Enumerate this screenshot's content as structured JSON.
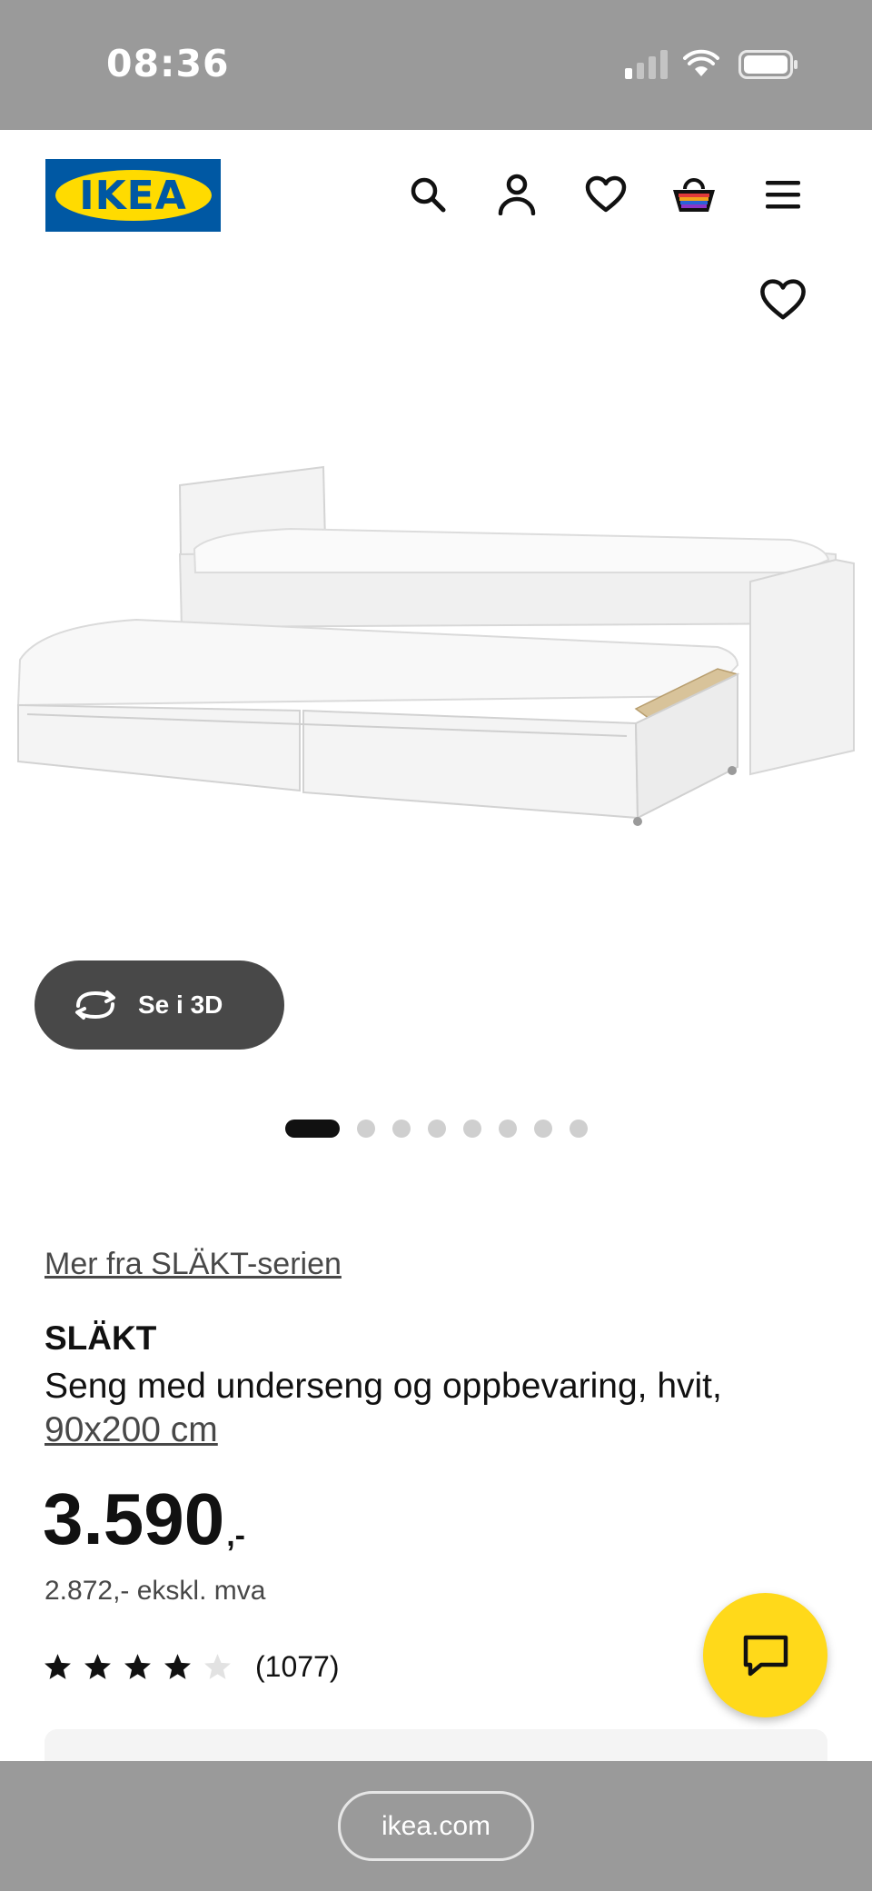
{
  "status_bar": {
    "time": "08:36"
  },
  "header": {
    "logo_text": "IKEA",
    "icons": [
      "search-icon",
      "account-icon",
      "heart-icon",
      "basket-icon",
      "menu-icon"
    ]
  },
  "gallery": {
    "view_3d_label": "Se i 3D",
    "slide_count": 8,
    "active_slide": 1
  },
  "product": {
    "series_link": "Mer fra SLÄKT-serien",
    "name": "SLÄKT",
    "description": "Seng med underseng og oppbevaring, hvit,",
    "size": "90x200 cm",
    "price_integer": "3.590",
    "price_suffix": ",-",
    "price_excl_vat": "2.872,- ekskl. mva",
    "rating": {
      "value": 4,
      "max": 5,
      "count_label": "(1077)"
    }
  },
  "browser": {
    "url": "ikea.com"
  },
  "colors": {
    "ikea_blue": "#0058a3",
    "ikea_yellow": "#ffdb00",
    "chat_yellow": "#ffd91a",
    "button_dark": "#484848",
    "status_gray": "#9a9a9a"
  }
}
